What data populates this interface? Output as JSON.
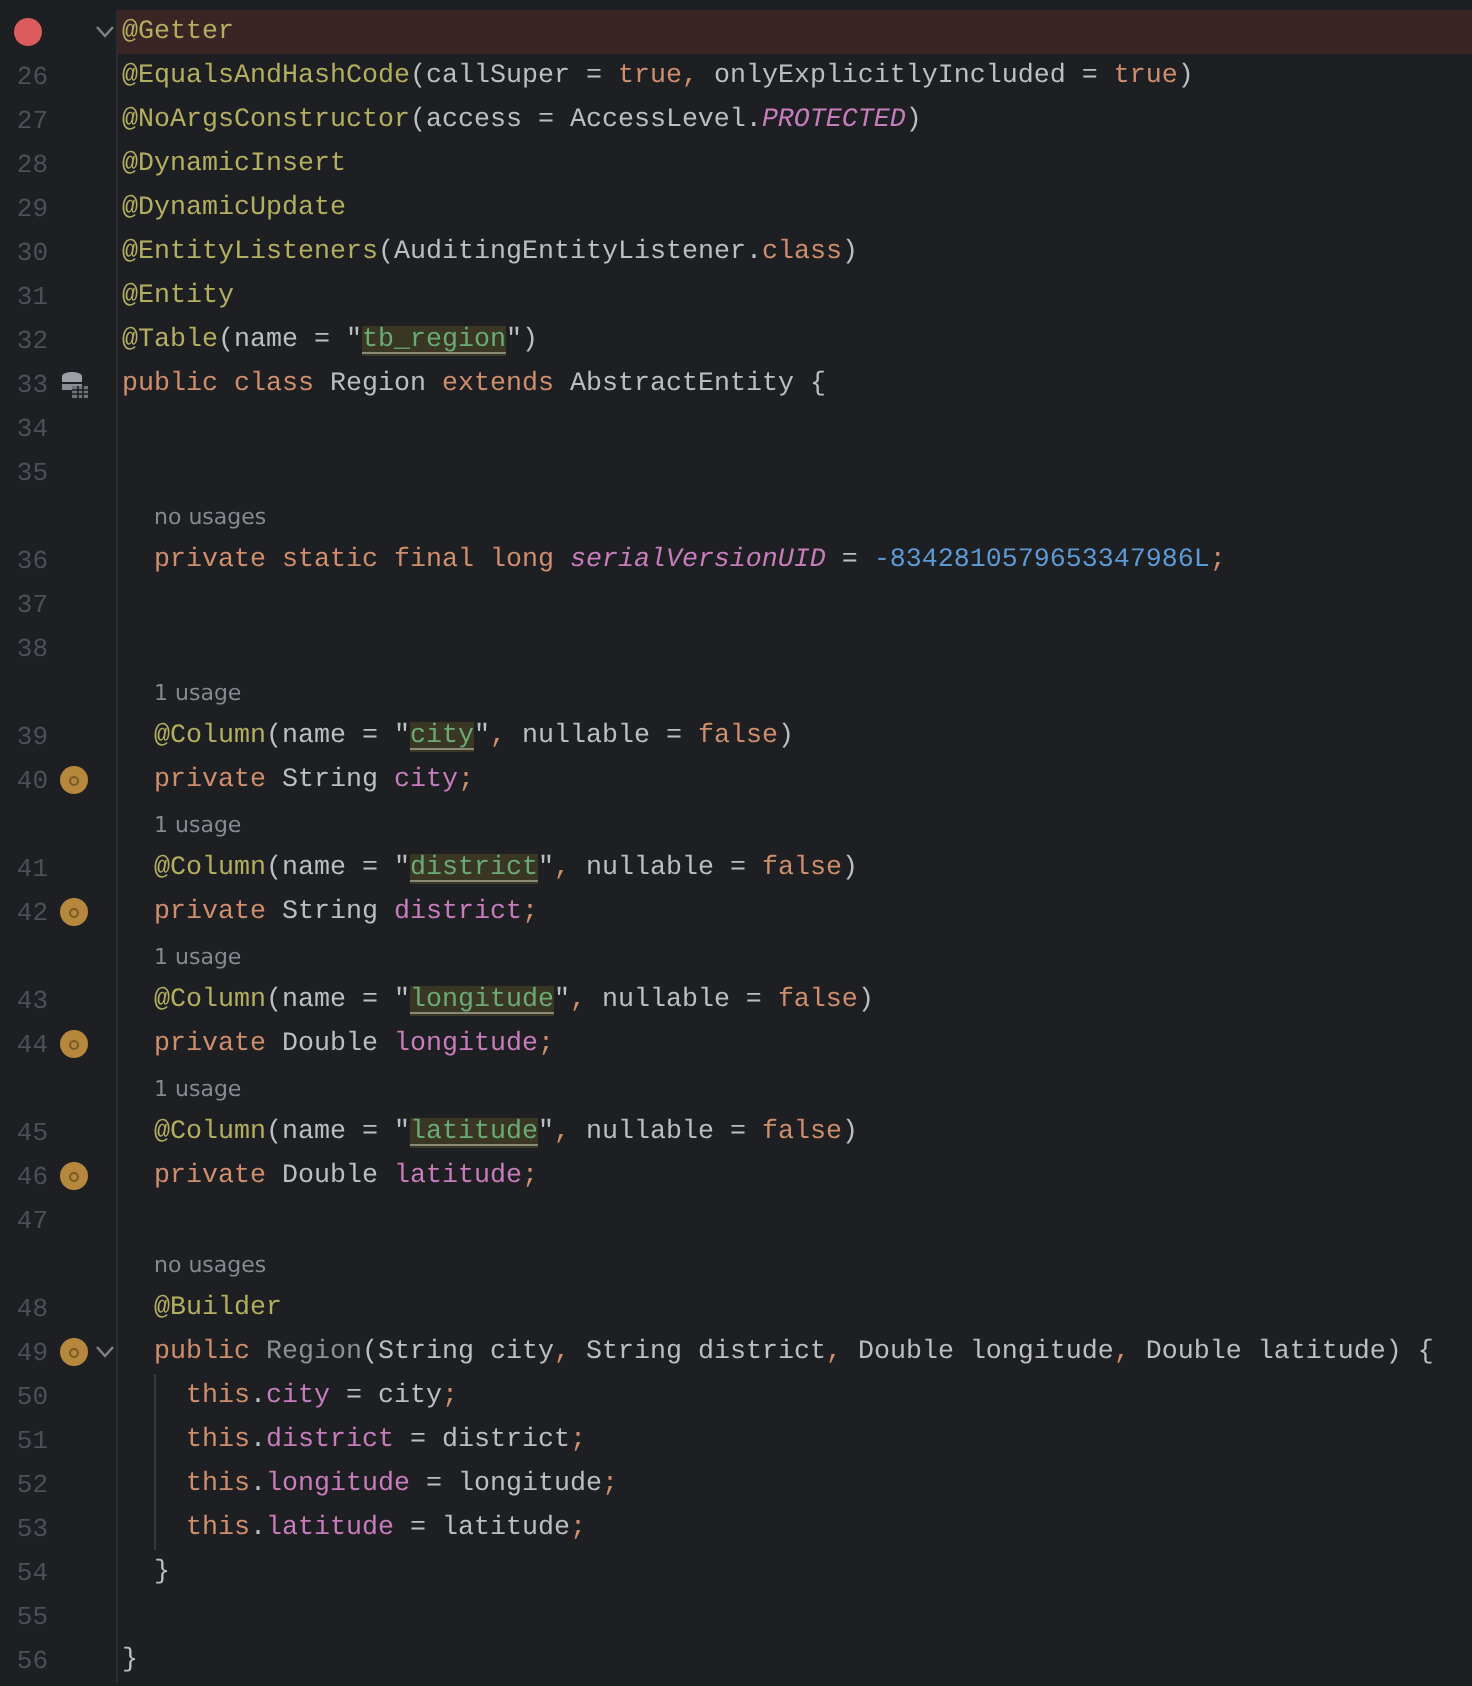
{
  "lines": [
    {
      "kind": "code",
      "breakpoint": true,
      "fold": true,
      "tokens": [
        {
          "kind": "an",
          "text": "@Getter"
        }
      ]
    },
    {
      "kind": "code",
      "number": "26",
      "breakpoint": false,
      "fold": false,
      "tokens": [
        {
          "kind": "an",
          "text": "@EqualsAndHashCode"
        },
        {
          "kind": "pl",
          "text": "(callSuper = "
        },
        {
          "kind": "kw",
          "text": "true"
        },
        {
          "kind": "kw",
          "text": ","
        },
        {
          "kind": "pl",
          "text": " onlyExplicitlyIncluded = "
        },
        {
          "kind": "kw",
          "text": "true"
        },
        {
          "kind": "pl",
          "text": ")"
        }
      ]
    },
    {
      "kind": "code",
      "number": "27",
      "breakpoint": false,
      "fold": false,
      "tokens": [
        {
          "kind": "an",
          "text": "@NoArgsConstructor"
        },
        {
          "kind": "pl",
          "text": "(access = AccessLevel."
        },
        {
          "kind": "sfld",
          "text": "PROTECTED"
        },
        {
          "kind": "pl",
          "text": ")"
        }
      ]
    },
    {
      "kind": "code",
      "number": "28",
      "breakpoint": false,
      "fold": false,
      "tokens": [
        {
          "kind": "an",
          "text": "@DynamicInsert"
        }
      ]
    },
    {
      "kind": "code",
      "number": "29",
      "breakpoint": false,
      "fold": false,
      "tokens": [
        {
          "kind": "an",
          "text": "@DynamicUpdate"
        }
      ]
    },
    {
      "kind": "code",
      "number": "30",
      "breakpoint": false,
      "fold": false,
      "tokens": [
        {
          "kind": "an",
          "text": "@EntityListeners"
        },
        {
          "kind": "pl",
          "text": "(AuditingEntityListener."
        },
        {
          "kind": "kw",
          "text": "class"
        },
        {
          "kind": "pl",
          "text": ")"
        }
      ]
    },
    {
      "kind": "code",
      "number": "31",
      "breakpoint": false,
      "fold": false,
      "tokens": [
        {
          "kind": "an",
          "text": "@Entity"
        }
      ]
    },
    {
      "kind": "code",
      "number": "32",
      "breakpoint": false,
      "fold": false,
      "tokens": [
        {
          "kind": "an",
          "text": "@Table"
        },
        {
          "kind": "pl",
          "text": "(name = \""
        },
        {
          "kind": "str",
          "text": "tb_region"
        },
        {
          "kind": "pl",
          "text": "\")"
        }
      ]
    },
    {
      "kind": "code",
      "number": "33",
      "breakpoint": false,
      "fold": false,
      "gutter": {
        "kind": "database"
      },
      "tokens": [
        {
          "kind": "kw",
          "text": "public class "
        },
        {
          "kind": "pl",
          "text": "Region "
        },
        {
          "kind": "kw",
          "text": "extends "
        },
        {
          "kind": "pl",
          "text": "AbstractEntity {"
        }
      ]
    },
    {
      "kind": "code",
      "number": "34",
      "breakpoint": false,
      "fold": false
    },
    {
      "kind": "code",
      "number": "35",
      "breakpoint": false,
      "fold": false
    },
    {
      "kind": "hint",
      "text": "no usages"
    },
    {
      "kind": "code",
      "number": "36",
      "breakpoint": false,
      "fold": false,
      "tokens": [
        {
          "kind": "kw",
          "text": "  private static final long "
        },
        {
          "kind": "sfld",
          "text": "serialVersionUID"
        },
        {
          "kind": "pl",
          "text": " = "
        },
        {
          "kind": "num",
          "text": "-8342810579653347986L"
        },
        {
          "kind": "kw",
          "text": ";"
        }
      ]
    },
    {
      "kind": "code",
      "number": "37",
      "breakpoint": false,
      "fold": false
    },
    {
      "kind": "code",
      "number": "38",
      "breakpoint": false,
      "fold": false
    },
    {
      "kind": "hint",
      "text": "1 usage"
    },
    {
      "kind": "code",
      "number": "39",
      "breakpoint": false,
      "fold": false,
      "tokens": [
        {
          "kind": "an",
          "text": "  @Column"
        },
        {
          "kind": "pl",
          "text": "(name = \""
        },
        {
          "kind": "str",
          "text": "city"
        },
        {
          "kind": "pl",
          "text": "\""
        },
        {
          "kind": "kw",
          "text": ","
        },
        {
          "kind": "pl",
          "text": " nullable = "
        },
        {
          "kind": "kw",
          "text": "false"
        },
        {
          "kind": "pl",
          "text": ")"
        }
      ]
    },
    {
      "kind": "code",
      "number": "40",
      "breakpoint": false,
      "fold": false,
      "gutter": {
        "kind": "field"
      },
      "tokens": [
        {
          "kind": "kw",
          "text": "  private "
        },
        {
          "kind": "pl",
          "text": "String "
        },
        {
          "kind": "fld",
          "text": "city"
        },
        {
          "kind": "kw",
          "text": ";"
        }
      ]
    },
    {
      "kind": "hint",
      "text": "1 usage"
    },
    {
      "kind": "code",
      "number": "41",
      "breakpoint": false,
      "fold": false,
      "tokens": [
        {
          "kind": "an",
          "text": "  @Column"
        },
        {
          "kind": "pl",
          "text": "(name = \""
        },
        {
          "kind": "str",
          "text": "district"
        },
        {
          "kind": "pl",
          "text": "\""
        },
        {
          "kind": "kw",
          "text": ","
        },
        {
          "kind": "pl",
          "text": " nullable = "
        },
        {
          "kind": "kw",
          "text": "false"
        },
        {
          "kind": "pl",
          "text": ")"
        }
      ]
    },
    {
      "kind": "code",
      "number": "42",
      "breakpoint": false,
      "fold": false,
      "gutter": {
        "kind": "field"
      },
      "tokens": [
        {
          "kind": "kw",
          "text": "  private "
        },
        {
          "kind": "pl",
          "text": "String "
        },
        {
          "kind": "fld",
          "text": "district"
        },
        {
          "kind": "kw",
          "text": ";"
        }
      ]
    },
    {
      "kind": "hint",
      "text": "1 usage"
    },
    {
      "kind": "code",
      "number": "43",
      "breakpoint": false,
      "fold": false,
      "tokens": [
        {
          "kind": "an",
          "text": "  @Column"
        },
        {
          "kind": "pl",
          "text": "(name = \""
        },
        {
          "kind": "str",
          "text": "longitude"
        },
        {
          "kind": "pl",
          "text": "\""
        },
        {
          "kind": "kw",
          "text": ","
        },
        {
          "kind": "pl",
          "text": " nullable = "
        },
        {
          "kind": "kw",
          "text": "false"
        },
        {
          "kind": "pl",
          "text": ")"
        }
      ]
    },
    {
      "kind": "code",
      "number": "44",
      "breakpoint": false,
      "fold": false,
      "gutter": {
        "kind": "field"
      },
      "tokens": [
        {
          "kind": "kw",
          "text": "  private "
        },
        {
          "kind": "pl",
          "text": "Double "
        },
        {
          "kind": "fld",
          "text": "longitude"
        },
        {
          "kind": "kw",
          "text": ";"
        }
      ]
    },
    {
      "kind": "hint",
      "text": "1 usage"
    },
    {
      "kind": "code",
      "number": "45",
      "breakpoint": false,
      "fold": false,
      "tokens": [
        {
          "kind": "an",
          "text": "  @Column"
        },
        {
          "kind": "pl",
          "text": "(name = \""
        },
        {
          "kind": "str",
          "text": "latitude"
        },
        {
          "kind": "pl",
          "text": "\""
        },
        {
          "kind": "kw",
          "text": ","
        },
        {
          "kind": "pl",
          "text": " nullable = "
        },
        {
          "kind": "kw",
          "text": "false"
        },
        {
          "kind": "pl",
          "text": ")"
        }
      ]
    },
    {
      "kind": "code",
      "number": "46",
      "breakpoint": false,
      "fold": false,
      "gutter": {
        "kind": "field"
      },
      "tokens": [
        {
          "kind": "kw",
          "text": "  private "
        },
        {
          "kind": "pl",
          "text": "Double "
        },
        {
          "kind": "fld",
          "text": "latitude"
        },
        {
          "kind": "kw",
          "text": ";"
        }
      ]
    },
    {
      "kind": "code",
      "number": "47",
      "breakpoint": false,
      "fold": false
    },
    {
      "kind": "hint",
      "text": "no usages"
    },
    {
      "kind": "code",
      "number": "48",
      "breakpoint": false,
      "fold": false,
      "tokens": [
        {
          "kind": "an",
          "text": "  @Builder"
        }
      ]
    },
    {
      "kind": "code",
      "number": "49",
      "breakpoint": false,
      "fold": true,
      "gutter": {
        "kind": "field"
      },
      "tokens": [
        {
          "kind": "kw",
          "text": "  public "
        },
        {
          "kind": "dim",
          "text": "Region"
        },
        {
          "kind": "pl",
          "text": "(String city"
        },
        {
          "kind": "kw",
          "text": ","
        },
        {
          "kind": "pl",
          "text": " String district"
        },
        {
          "kind": "kw",
          "text": ","
        },
        {
          "kind": "pl",
          "text": " Double longitude"
        },
        {
          "kind": "kw",
          "text": ","
        },
        {
          "kind": "pl",
          "text": " Double latitude) {"
        }
      ]
    },
    {
      "kind": "code",
      "number": "50",
      "breakpoint": false,
      "fold": false,
      "tokens": [
        {
          "kind": "kw",
          "text": "    this"
        },
        {
          "kind": "pl",
          "text": "."
        },
        {
          "kind": "fld",
          "text": "city"
        },
        {
          "kind": "pl",
          "text": " = city"
        },
        {
          "kind": "kw",
          "text": ";"
        }
      ]
    },
    {
      "kind": "code",
      "number": "51",
      "breakpoint": false,
      "fold": false,
      "tokens": [
        {
          "kind": "kw",
          "text": "    this"
        },
        {
          "kind": "pl",
          "text": "."
        },
        {
          "kind": "fld",
          "text": "district"
        },
        {
          "kind": "pl",
          "text": " = district"
        },
        {
          "kind": "kw",
          "text": ";"
        }
      ]
    },
    {
      "kind": "code",
      "number": "52",
      "breakpoint": false,
      "fold": false,
      "tokens": [
        {
          "kind": "kw",
          "text": "    this"
        },
        {
          "kind": "pl",
          "text": "."
        },
        {
          "kind": "fld",
          "text": "longitude"
        },
        {
          "kind": "pl",
          "text": " = longitude"
        },
        {
          "kind": "kw",
          "text": ";"
        }
      ]
    },
    {
      "kind": "code",
      "number": "53",
      "breakpoint": false,
      "fold": false,
      "tokens": [
        {
          "kind": "kw",
          "text": "    this"
        },
        {
          "kind": "pl",
          "text": "."
        },
        {
          "kind": "fld",
          "text": "latitude"
        },
        {
          "kind": "pl",
          "text": " = latitude"
        },
        {
          "kind": "kw",
          "text": ";"
        }
      ]
    },
    {
      "kind": "code",
      "number": "54",
      "breakpoint": false,
      "fold": false,
      "tokens": [
        {
          "kind": "pl",
          "text": "  }"
        }
      ]
    },
    {
      "kind": "code",
      "number": "55",
      "breakpoint": false,
      "fold": false
    },
    {
      "kind": "code",
      "number": "56",
      "breakpoint": false,
      "fold": false,
      "tokens": [
        {
          "kind": "pl",
          "text": "}"
        }
      ]
    }
  ]
}
